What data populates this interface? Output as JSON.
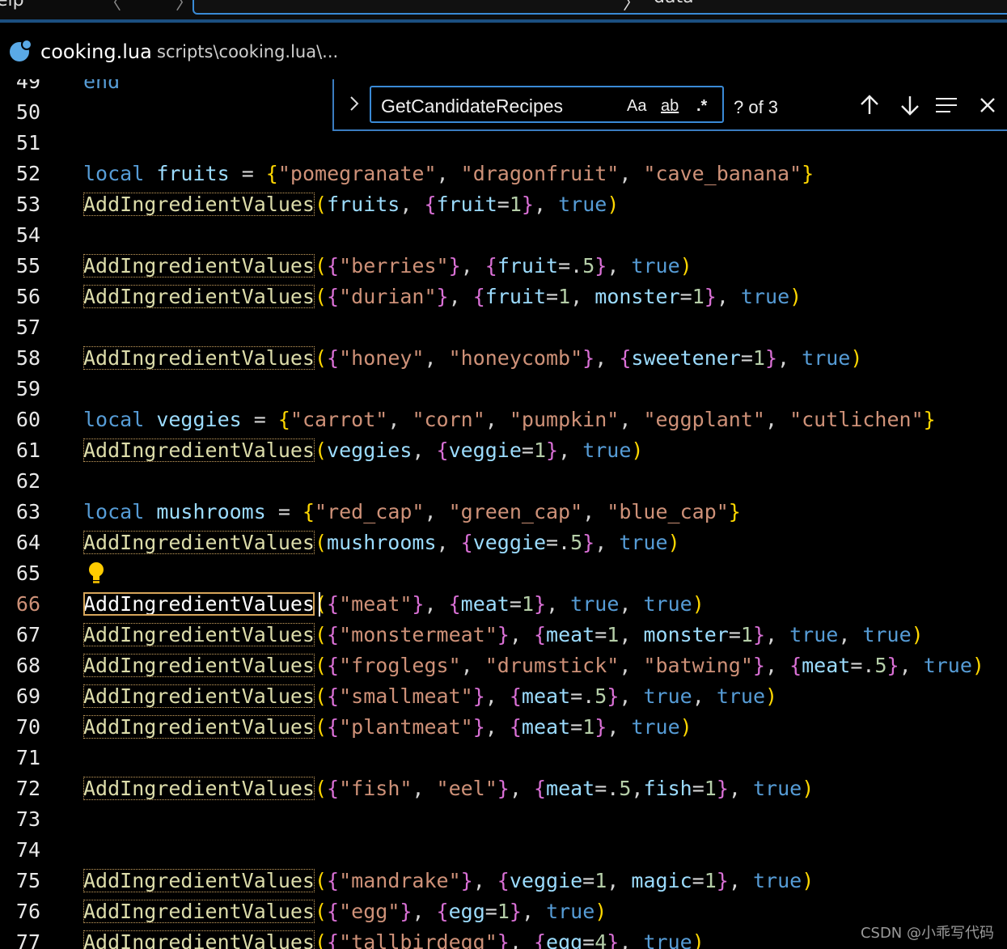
{
  "topbar": {
    "menu_tail": "elp",
    "nav": "〈 〉",
    "command_tail": "〉",
    "command_sub": "data"
  },
  "tab": {
    "icon": "lua-file-icon",
    "name": "cooking.lua",
    "path": "scripts\\cooking.lua\\..."
  },
  "find": {
    "query": "GetCandidateRecipes",
    "match_case": "Aa",
    "whole_word": "ab",
    "regex": ".*",
    "count": "? of 3",
    "icons": [
      "chevron-right-icon",
      "arrow-up-icon",
      "arrow-down-icon",
      "find-in-selection-icon",
      "close-icon"
    ]
  },
  "editor": {
    "active_line": "66",
    "lines": [
      {
        "n": "49",
        "t": [
          [
            "kw",
            "end"
          ]
        ]
      },
      {
        "n": "50",
        "t": []
      },
      {
        "n": "51",
        "t": []
      },
      {
        "n": "52",
        "t": [
          [
            "kw",
            "local"
          ],
          [
            "op",
            " "
          ],
          [
            "var",
            "fruits"
          ],
          [
            "op",
            " = "
          ],
          [
            "b1",
            "{"
          ],
          [
            "str",
            "\"pomegranate\""
          ],
          [
            "op",
            ", "
          ],
          [
            "str",
            "\"dragonfruit\""
          ],
          [
            "op",
            ", "
          ],
          [
            "str",
            "\"cave_banana\""
          ],
          [
            "b1",
            "}"
          ]
        ]
      },
      {
        "n": "53",
        "t": [
          [
            "fn",
            "AddIngredientValues"
          ],
          [
            "b1",
            "("
          ],
          [
            "var",
            "fruits"
          ],
          [
            "op",
            ", "
          ],
          [
            "b2",
            "{"
          ],
          [
            "var",
            "fruit"
          ],
          [
            "op",
            "="
          ],
          [
            "num",
            "1"
          ],
          [
            "b2",
            "}"
          ],
          [
            "op",
            ", "
          ],
          [
            "bool",
            "true"
          ],
          [
            "b1",
            ")"
          ]
        ]
      },
      {
        "n": "54",
        "t": []
      },
      {
        "n": "55",
        "t": [
          [
            "fn",
            "AddIngredientValues"
          ],
          [
            "b1",
            "("
          ],
          [
            "b2",
            "{"
          ],
          [
            "str",
            "\"berries\""
          ],
          [
            "b2",
            "}"
          ],
          [
            "op",
            ", "
          ],
          [
            "b2",
            "{"
          ],
          [
            "var",
            "fruit"
          ],
          [
            "op",
            "=."
          ],
          [
            "num",
            "5"
          ],
          [
            "b2",
            "}"
          ],
          [
            "op",
            ", "
          ],
          [
            "bool",
            "true"
          ],
          [
            "b1",
            ")"
          ]
        ]
      },
      {
        "n": "56",
        "t": [
          [
            "fn",
            "AddIngredientValues"
          ],
          [
            "b1",
            "("
          ],
          [
            "b2",
            "{"
          ],
          [
            "str",
            "\"durian\""
          ],
          [
            "b2",
            "}"
          ],
          [
            "op",
            ", "
          ],
          [
            "b2",
            "{"
          ],
          [
            "var",
            "fruit"
          ],
          [
            "op",
            "="
          ],
          [
            "num",
            "1"
          ],
          [
            "op",
            ", "
          ],
          [
            "var",
            "monster"
          ],
          [
            "op",
            "="
          ],
          [
            "num",
            "1"
          ],
          [
            "b2",
            "}"
          ],
          [
            "op",
            ", "
          ],
          [
            "bool",
            "true"
          ],
          [
            "b1",
            ")"
          ]
        ]
      },
      {
        "n": "57",
        "t": []
      },
      {
        "n": "58",
        "t": [
          [
            "fn",
            "AddIngredientValues"
          ],
          [
            "b1",
            "("
          ],
          [
            "b2",
            "{"
          ],
          [
            "str",
            "\"honey\""
          ],
          [
            "op",
            ", "
          ],
          [
            "str",
            "\"honeycomb\""
          ],
          [
            "b2",
            "}"
          ],
          [
            "op",
            ", "
          ],
          [
            "b2",
            "{"
          ],
          [
            "var",
            "sweetener"
          ],
          [
            "op",
            "="
          ],
          [
            "num",
            "1"
          ],
          [
            "b2",
            "}"
          ],
          [
            "op",
            ", "
          ],
          [
            "bool",
            "true"
          ],
          [
            "b1",
            ")"
          ]
        ]
      },
      {
        "n": "59",
        "t": []
      },
      {
        "n": "60",
        "t": [
          [
            "kw",
            "local"
          ],
          [
            "op",
            " "
          ],
          [
            "var",
            "veggies"
          ],
          [
            "op",
            " = "
          ],
          [
            "b1",
            "{"
          ],
          [
            "str",
            "\"carrot\""
          ],
          [
            "op",
            ", "
          ],
          [
            "str",
            "\"corn\""
          ],
          [
            "op",
            ", "
          ],
          [
            "str",
            "\"pumpkin\""
          ],
          [
            "op",
            ", "
          ],
          [
            "str",
            "\"eggplant\""
          ],
          [
            "op",
            ", "
          ],
          [
            "str",
            "\"cutlichen\""
          ],
          [
            "b1",
            "}"
          ]
        ]
      },
      {
        "n": "61",
        "t": [
          [
            "fn",
            "AddIngredientValues"
          ],
          [
            "b1",
            "("
          ],
          [
            "var",
            "veggies"
          ],
          [
            "op",
            ", "
          ],
          [
            "b2",
            "{"
          ],
          [
            "var",
            "veggie"
          ],
          [
            "op",
            "="
          ],
          [
            "num",
            "1"
          ],
          [
            "b2",
            "}"
          ],
          [
            "op",
            ", "
          ],
          [
            "bool",
            "true"
          ],
          [
            "b1",
            ")"
          ]
        ]
      },
      {
        "n": "62",
        "t": []
      },
      {
        "n": "63",
        "t": [
          [
            "kw",
            "local"
          ],
          [
            "op",
            " "
          ],
          [
            "var",
            "mushrooms"
          ],
          [
            "op",
            " = "
          ],
          [
            "b1",
            "{"
          ],
          [
            "str",
            "\"red_cap\""
          ],
          [
            "op",
            ", "
          ],
          [
            "str",
            "\"green_cap\""
          ],
          [
            "op",
            ", "
          ],
          [
            "str",
            "\"blue_cap\""
          ],
          [
            "b1",
            "}"
          ]
        ]
      },
      {
        "n": "64",
        "t": [
          [
            "fn",
            "AddIngredientValues"
          ],
          [
            "b1",
            "("
          ],
          [
            "var",
            "mushrooms"
          ],
          [
            "op",
            ", "
          ],
          [
            "b2",
            "{"
          ],
          [
            "var",
            "veggie"
          ],
          [
            "op",
            "=."
          ],
          [
            "num",
            "5"
          ],
          [
            "b2",
            "}"
          ],
          [
            "op",
            ", "
          ],
          [
            "bool",
            "true"
          ],
          [
            "b1",
            ")"
          ]
        ]
      },
      {
        "n": "65",
        "t": []
      },
      {
        "n": "66",
        "t": [
          [
            "fnsel",
            "AddIngredientValues"
          ],
          [
            "b1",
            "("
          ],
          [
            "b2",
            "{"
          ],
          [
            "str",
            "\"meat\""
          ],
          [
            "b2",
            "}"
          ],
          [
            "op",
            ", "
          ],
          [
            "b2",
            "{"
          ],
          [
            "var",
            "meat"
          ],
          [
            "op",
            "="
          ],
          [
            "num",
            "1"
          ],
          [
            "b2",
            "}"
          ],
          [
            "op",
            ", "
          ],
          [
            "bool",
            "true"
          ],
          [
            "op",
            ", "
          ],
          [
            "bool",
            "true"
          ],
          [
            "b1",
            ")"
          ]
        ]
      },
      {
        "n": "67",
        "t": [
          [
            "fn",
            "AddIngredientValues"
          ],
          [
            "b1",
            "("
          ],
          [
            "b2",
            "{"
          ],
          [
            "str",
            "\"monstermeat\""
          ],
          [
            "b2",
            "}"
          ],
          [
            "op",
            ", "
          ],
          [
            "b2",
            "{"
          ],
          [
            "var",
            "meat"
          ],
          [
            "op",
            "="
          ],
          [
            "num",
            "1"
          ],
          [
            "op",
            ", "
          ],
          [
            "var",
            "monster"
          ],
          [
            "op",
            "="
          ],
          [
            "num",
            "1"
          ],
          [
            "b2",
            "}"
          ],
          [
            "op",
            ", "
          ],
          [
            "bool",
            "true"
          ],
          [
            "op",
            ", "
          ],
          [
            "bool",
            "true"
          ],
          [
            "b1",
            ")"
          ]
        ]
      },
      {
        "n": "68",
        "t": [
          [
            "fn",
            "AddIngredientValues"
          ],
          [
            "b1",
            "("
          ],
          [
            "b2",
            "{"
          ],
          [
            "str",
            "\"froglegs\""
          ],
          [
            "op",
            ", "
          ],
          [
            "str",
            "\"drumstick\""
          ],
          [
            "op",
            ", "
          ],
          [
            "str",
            "\"batwing\""
          ],
          [
            "b2",
            "}"
          ],
          [
            "op",
            ", "
          ],
          [
            "b2",
            "{"
          ],
          [
            "var",
            "meat"
          ],
          [
            "op",
            "=."
          ],
          [
            "num",
            "5"
          ],
          [
            "b2",
            "}"
          ],
          [
            "op",
            ", "
          ],
          [
            "bool",
            "true"
          ],
          [
            "b1",
            ")"
          ]
        ]
      },
      {
        "n": "69",
        "t": [
          [
            "fn",
            "AddIngredientValues"
          ],
          [
            "b1",
            "("
          ],
          [
            "b2",
            "{"
          ],
          [
            "str",
            "\"smallmeat\""
          ],
          [
            "b2",
            "}"
          ],
          [
            "op",
            ", "
          ],
          [
            "b2",
            "{"
          ],
          [
            "var",
            "meat"
          ],
          [
            "op",
            "=."
          ],
          [
            "num",
            "5"
          ],
          [
            "b2",
            "}"
          ],
          [
            "op",
            ", "
          ],
          [
            "bool",
            "true"
          ],
          [
            "op",
            ", "
          ],
          [
            "bool",
            "true"
          ],
          [
            "b1",
            ")"
          ]
        ]
      },
      {
        "n": "70",
        "t": [
          [
            "fn",
            "AddIngredientValues"
          ],
          [
            "b1",
            "("
          ],
          [
            "b2",
            "{"
          ],
          [
            "str",
            "\"plantmeat\""
          ],
          [
            "b2",
            "}"
          ],
          [
            "op",
            ", "
          ],
          [
            "b2",
            "{"
          ],
          [
            "var",
            "meat"
          ],
          [
            "op",
            "="
          ],
          [
            "num",
            "1"
          ],
          [
            "b2",
            "}"
          ],
          [
            "op",
            ", "
          ],
          [
            "bool",
            "true"
          ],
          [
            "b1",
            ")"
          ]
        ]
      },
      {
        "n": "71",
        "t": []
      },
      {
        "n": "72",
        "t": [
          [
            "fn",
            "AddIngredientValues"
          ],
          [
            "b1",
            "("
          ],
          [
            "b2",
            "{"
          ],
          [
            "str",
            "\"fish\""
          ],
          [
            "op",
            ", "
          ],
          [
            "str",
            "\"eel\""
          ],
          [
            "b2",
            "}"
          ],
          [
            "op",
            ", "
          ],
          [
            "b2",
            "{"
          ],
          [
            "var",
            "meat"
          ],
          [
            "op",
            "=."
          ],
          [
            "num",
            "5"
          ],
          [
            "op",
            ","
          ],
          [
            "var",
            "fish"
          ],
          [
            "op",
            "="
          ],
          [
            "num",
            "1"
          ],
          [
            "b2",
            "}"
          ],
          [
            "op",
            ", "
          ],
          [
            "bool",
            "true"
          ],
          [
            "b1",
            ")"
          ]
        ]
      },
      {
        "n": "73",
        "t": []
      },
      {
        "n": "74",
        "t": []
      },
      {
        "n": "75",
        "t": [
          [
            "fn",
            "AddIngredientValues"
          ],
          [
            "b1",
            "("
          ],
          [
            "b2",
            "{"
          ],
          [
            "str",
            "\"mandrake\""
          ],
          [
            "b2",
            "}"
          ],
          [
            "op",
            ", "
          ],
          [
            "b2",
            "{"
          ],
          [
            "var",
            "veggie"
          ],
          [
            "op",
            "="
          ],
          [
            "num",
            "1"
          ],
          [
            "op",
            ", "
          ],
          [
            "var",
            "magic"
          ],
          [
            "op",
            "="
          ],
          [
            "num",
            "1"
          ],
          [
            "b2",
            "}"
          ],
          [
            "op",
            ", "
          ],
          [
            "bool",
            "true"
          ],
          [
            "b1",
            ")"
          ]
        ]
      },
      {
        "n": "76",
        "t": [
          [
            "fn",
            "AddIngredientValues"
          ],
          [
            "b1",
            "("
          ],
          [
            "b2",
            "{"
          ],
          [
            "str",
            "\"egg\""
          ],
          [
            "b2",
            "}"
          ],
          [
            "op",
            ", "
          ],
          [
            "b2",
            "{"
          ],
          [
            "var",
            "egg"
          ],
          [
            "op",
            "="
          ],
          [
            "num",
            "1"
          ],
          [
            "b2",
            "}"
          ],
          [
            "op",
            ", "
          ],
          [
            "bool",
            "true"
          ],
          [
            "b1",
            ")"
          ]
        ]
      },
      {
        "n": "77",
        "t": [
          [
            "fn",
            "AddIngredientValues"
          ],
          [
            "b1",
            "("
          ],
          [
            "b2",
            "{"
          ],
          [
            "str",
            "\"tallbirdegg\""
          ],
          [
            "b2",
            "}"
          ],
          [
            "op",
            ", "
          ],
          [
            "b2",
            "{"
          ],
          [
            "var",
            "egg"
          ],
          [
            "op",
            "="
          ],
          [
            "num",
            "4"
          ],
          [
            "b2",
            "}"
          ],
          [
            "op",
            ", "
          ],
          [
            "bool",
            "true"
          ],
          [
            "b1",
            ")"
          ]
        ]
      }
    ]
  },
  "lightbulb": {
    "icon": "lightbulb-icon",
    "line": "65"
  },
  "watermark": "CSDN @小乖写代码"
}
